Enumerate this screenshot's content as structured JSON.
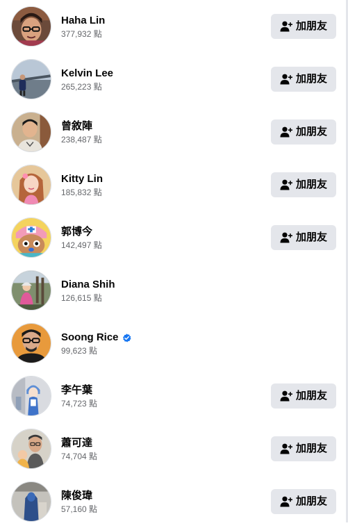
{
  "people": [
    {
      "name": "Haha Lin",
      "points": "377,932 點",
      "verified": false,
      "button": "加朋友",
      "avatar": "avatar-glasses-man"
    },
    {
      "name": "Kelvin Lee",
      "points": "265,223 點",
      "verified": false,
      "button": "加朋友",
      "avatar": "avatar-man-outdoor-bridge"
    },
    {
      "name": "曾敘陣",
      "points": "238,487 點",
      "verified": false,
      "button": "加朋友",
      "avatar": "avatar-young-man"
    },
    {
      "name": "Kitty Lin",
      "points": "185,832 點",
      "verified": false,
      "button": "加朋友",
      "avatar": "avatar-woman-pink"
    },
    {
      "name": "郭博今",
      "points": "142,497 點",
      "verified": false,
      "button": "加朋友",
      "avatar": "avatar-cartoon-reindeer"
    },
    {
      "name": "Diana Shih",
      "points": "126,615 點",
      "verified": false,
      "button": null,
      "avatar": "avatar-child-outdoor"
    },
    {
      "name": "Soong Rice",
      "points": "99,623 點",
      "verified": true,
      "button": null,
      "avatar": "avatar-man-glasses-orange"
    },
    {
      "name": "李午葉",
      "points": "74,723 點",
      "verified": false,
      "button": "加朋友",
      "avatar": "avatar-anime-figure"
    },
    {
      "name": "蕭可達",
      "points": "74,704 點",
      "verified": false,
      "button": "加朋友",
      "avatar": "avatar-man-with-child"
    },
    {
      "name": "陳俊瑋",
      "points": "57,160 點",
      "verified": false,
      "button": "加朋友",
      "avatar": "avatar-blue-figure"
    }
  ],
  "colors": {
    "button_bg": "#e4e6eb",
    "text_primary": "#050505",
    "text_secondary": "#65676b",
    "verified_blue": "#1877f2"
  }
}
